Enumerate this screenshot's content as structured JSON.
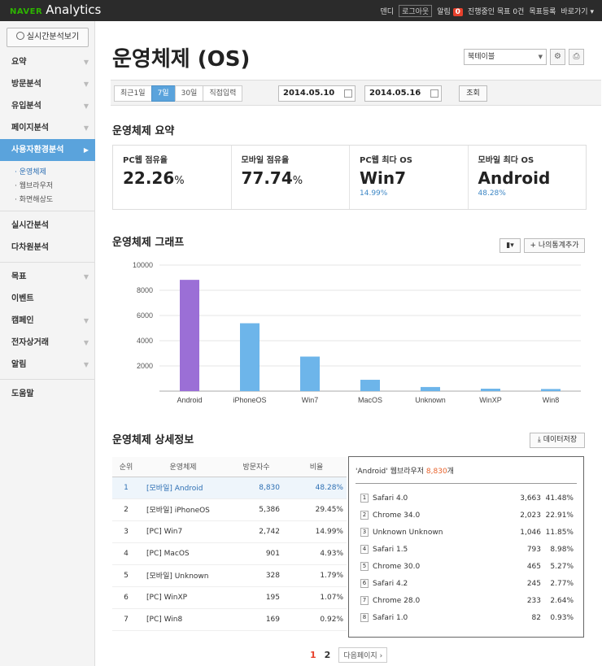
{
  "app": {
    "brand_small": "NAVER",
    "brand": "Analytics"
  },
  "topnav": {
    "user": "덴디",
    "logout": "로그아웃",
    "alerts_label": "알림",
    "alerts_count": "0",
    "goals_text": "진행중인 목표 0건",
    "goal_register": "목표등록",
    "shortcuts": "바로가기"
  },
  "sidebar": {
    "realtime_button": "실시간분석보기",
    "items": [
      {
        "label": "요약"
      },
      {
        "label": "방문분석"
      },
      {
        "label": "유입분석"
      },
      {
        "label": "페이지분석"
      },
      {
        "label": "사용자환경분석"
      }
    ],
    "sub_items": [
      {
        "label": "운영체제"
      },
      {
        "label": "웹브라우저"
      },
      {
        "label": "화면해상도"
      }
    ],
    "items2": [
      {
        "label": "실시간분석"
      },
      {
        "label": "다차원분석"
      }
    ],
    "items3": [
      {
        "label": "목표"
      },
      {
        "label": "이벤트"
      },
      {
        "label": "캠페인"
      },
      {
        "label": "전자상거래"
      },
      {
        "label": "알림"
      }
    ],
    "help": "도움말"
  },
  "header": {
    "title": "운영체제 (OS)",
    "bookmark_select": "북테이블"
  },
  "filter": {
    "tabs": [
      "최근1일",
      "7일",
      "30일",
      "직접입력"
    ],
    "start_date": "2014.05.10",
    "end_date": "2014.05.16",
    "lookup": "조회"
  },
  "summary": {
    "title": "운영체제 요약",
    "cells": [
      {
        "label": "PC웹 점유율",
        "value": "22.26",
        "unit": "%",
        "sub": ""
      },
      {
        "label": "모바일 점유율",
        "value": "77.74",
        "unit": "%",
        "sub": ""
      },
      {
        "label": "PC웹 최다 OS",
        "value": "Win7",
        "unit": "",
        "sub": "14.99%"
      },
      {
        "label": "모바일 최다 OS",
        "value": "Android",
        "unit": "",
        "sub": "48.28%"
      }
    ]
  },
  "graph": {
    "title": "운영체제 그래프",
    "add_stat": "나의통계추가"
  },
  "chart_data": {
    "type": "bar",
    "categories": [
      "Android",
      "iPhoneOS",
      "Win7",
      "MacOS",
      "Unknown",
      "WinXP",
      "Win8"
    ],
    "values": [
      8830,
      5386,
      2742,
      901,
      328,
      195,
      169
    ],
    "colors": [
      "#9b6fd6",
      "#6db5ea",
      "#6db5ea",
      "#6db5ea",
      "#6db5ea",
      "#6db5ea",
      "#6db5ea"
    ],
    "yticks": [
      "10000",
      "8000",
      "6000",
      "4000",
      "2000"
    ],
    "ylim": [
      0,
      10000
    ],
    "grid": true
  },
  "detail": {
    "title": "운영체제 상세정보",
    "download": "데이터저장",
    "headers": [
      "순위",
      "운영체제",
      "방문자수",
      "비율"
    ],
    "rows": [
      {
        "rank": "1",
        "os": "[모바일] Android",
        "visits": "8,830",
        "rate": "48.28%"
      },
      {
        "rank": "2",
        "os": "[모바일] iPhoneOS",
        "visits": "5,386",
        "rate": "29.45%"
      },
      {
        "rank": "3",
        "os": "[PC] Win7",
        "visits": "2,742",
        "rate": "14.99%"
      },
      {
        "rank": "4",
        "os": "[PC] MacOS",
        "visits": "901",
        "rate": "4.93%"
      },
      {
        "rank": "5",
        "os": "[모바일] Unknown",
        "visits": "328",
        "rate": "1.79%"
      },
      {
        "rank": "6",
        "os": "[PC] WinXP",
        "visits": "195",
        "rate": "1.07%"
      },
      {
        "rank": "7",
        "os": "[PC] Win8",
        "visits": "169",
        "rate": "0.92%"
      }
    ]
  },
  "browsers": {
    "os_name": "'Android'",
    "label": "웹브라우저",
    "count": "8,830",
    "count_unit": "개",
    "rows": [
      {
        "n": "1",
        "name": "Safari 4.0",
        "count": "3,663",
        "pct": "41.48%"
      },
      {
        "n": "2",
        "name": "Chrome 34.0",
        "count": "2,023",
        "pct": "22.91%"
      },
      {
        "n": "3",
        "name": "Unknown Unknown",
        "count": "1,046",
        "pct": "11.85%"
      },
      {
        "n": "4",
        "name": "Safari 1.5",
        "count": "793",
        "pct": "8.98%"
      },
      {
        "n": "5",
        "name": "Chrome 30.0",
        "count": "465",
        "pct": "5.27%"
      },
      {
        "n": "6",
        "name": "Safari 4.2",
        "count": "245",
        "pct": "2.77%"
      },
      {
        "n": "7",
        "name": "Chrome 28.0",
        "count": "233",
        "pct": "2.64%"
      },
      {
        "n": "8",
        "name": "Safari 1.0",
        "count": "82",
        "pct": "0.93%"
      }
    ]
  },
  "pager": {
    "pages": [
      "1",
      "2"
    ],
    "next": "다음페이지"
  }
}
